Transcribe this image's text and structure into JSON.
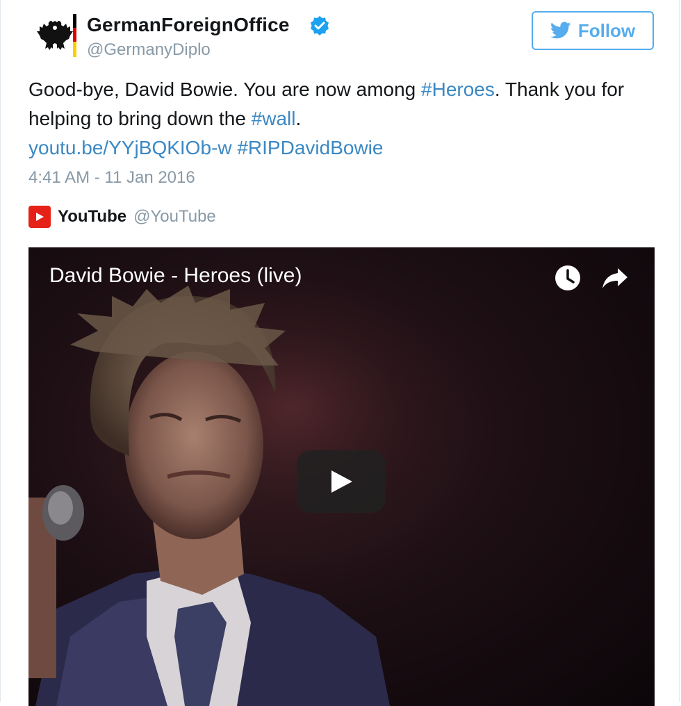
{
  "tweet": {
    "display_name": "GermanForeignOffice",
    "handle": "@GermanyDiplo",
    "verified": true,
    "follow_label": "Follow",
    "text_parts": {
      "p1": "Good-bye, David Bowie. You are now among ",
      "hashtag1": "#Heroes",
      "p2": ". Thank you for helping to bring down the ",
      "hashtag2": "#wall",
      "p3": ".",
      "link": "youtu.be/YYjBQKIOb-w",
      "hashtag3": "#RIPDavidBowie"
    },
    "timestamp": "4:41 AM - 11 Jan 2016"
  },
  "card": {
    "source_name": "YouTube",
    "source_handle": "@YouTube",
    "video_title": "David Bowie - Heroes (live)"
  },
  "colors": {
    "link": "#3b88c3",
    "follow": "#55acee",
    "youtube_red": "#e62117",
    "verified": "#1da1f2"
  },
  "icons": [
    "eagle-logo-icon",
    "verified-badge-icon",
    "twitter-bird-icon",
    "youtube-logo-icon",
    "watch-later-icon",
    "share-icon",
    "play-icon"
  ]
}
